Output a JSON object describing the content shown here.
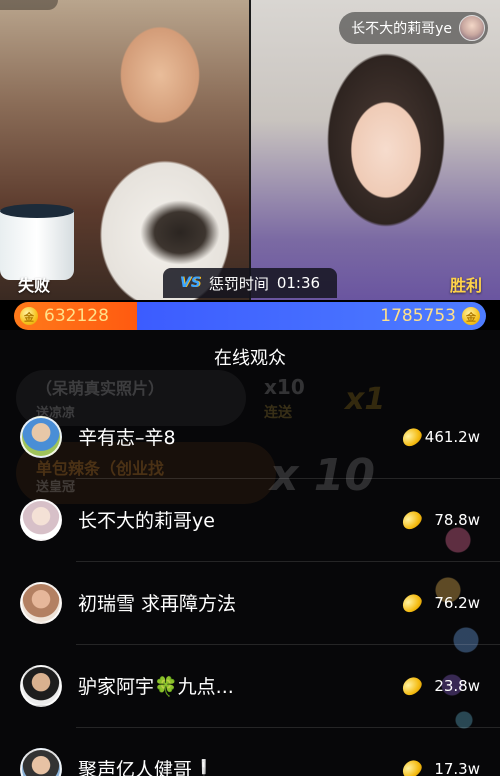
{
  "header": {
    "anchor_name": "长不大的莉哥ye"
  },
  "pk": {
    "left_result": "失败",
    "right_result": "胜利",
    "vs_label": "VS",
    "timer_label": "惩罚时间",
    "timer_value": "01:36",
    "left_score": "632128",
    "right_score": "1785753",
    "left_fraction": 0.26,
    "left_color": "#ff6a14",
    "right_color": "#4a6dff"
  },
  "background_messages": {
    "a": "（呆萌真实照片）",
    "b": "送凉凉",
    "c": "x10",
    "d": "连送",
    "e": "x1",
    "f": "单包辣条（创业找",
    "g": "送皇冠",
    "h": "x 10"
  },
  "audience": {
    "title": "在线观众",
    "users": [
      {
        "name": "辛有志–辛8",
        "amount": "461.2w"
      },
      {
        "name": "长不大的莉哥ye",
        "amount": "78.8w"
      },
      {
        "name": "初瑞雪 求再障方法",
        "amount": "76.2w"
      },
      {
        "name": "驴家阿宇🍀九点...",
        "amount": "23.8w"
      },
      {
        "name": "聚声亿人健哥❕",
        "amount": "17.3w"
      }
    ]
  }
}
